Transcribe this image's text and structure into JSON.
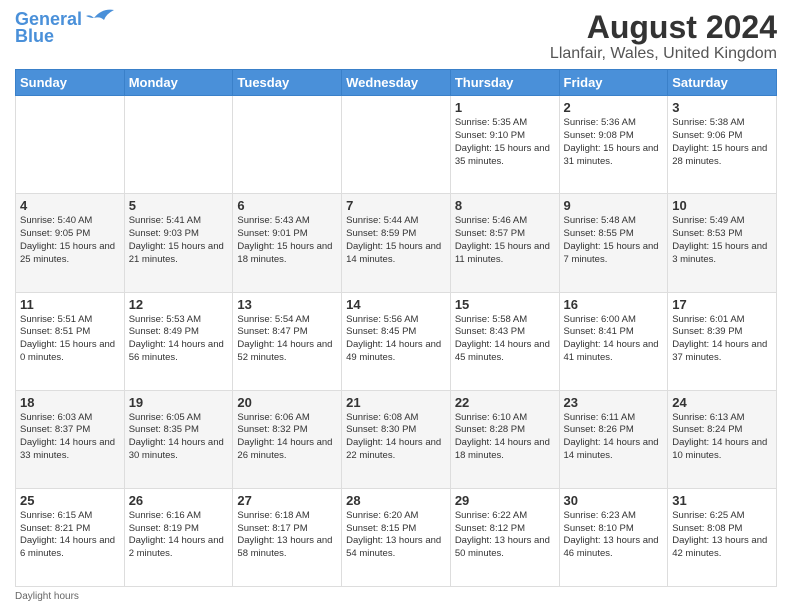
{
  "header": {
    "logo_line1": "General",
    "logo_line2": "Blue",
    "title": "August 2024",
    "subtitle": "Llanfair, Wales, United Kingdom"
  },
  "weekdays": [
    "Sunday",
    "Monday",
    "Tuesday",
    "Wednesday",
    "Thursday",
    "Friday",
    "Saturday"
  ],
  "weeks": [
    [
      {
        "day": "",
        "info": ""
      },
      {
        "day": "",
        "info": ""
      },
      {
        "day": "",
        "info": ""
      },
      {
        "day": "",
        "info": ""
      },
      {
        "day": "1",
        "info": "Sunrise: 5:35 AM\nSunset: 9:10 PM\nDaylight: 15 hours\nand 35 minutes."
      },
      {
        "day": "2",
        "info": "Sunrise: 5:36 AM\nSunset: 9:08 PM\nDaylight: 15 hours\nand 31 minutes."
      },
      {
        "day": "3",
        "info": "Sunrise: 5:38 AM\nSunset: 9:06 PM\nDaylight: 15 hours\nand 28 minutes."
      }
    ],
    [
      {
        "day": "4",
        "info": "Sunrise: 5:40 AM\nSunset: 9:05 PM\nDaylight: 15 hours\nand 25 minutes."
      },
      {
        "day": "5",
        "info": "Sunrise: 5:41 AM\nSunset: 9:03 PM\nDaylight: 15 hours\nand 21 minutes."
      },
      {
        "day": "6",
        "info": "Sunrise: 5:43 AM\nSunset: 9:01 PM\nDaylight: 15 hours\nand 18 minutes."
      },
      {
        "day": "7",
        "info": "Sunrise: 5:44 AM\nSunset: 8:59 PM\nDaylight: 15 hours\nand 14 minutes."
      },
      {
        "day": "8",
        "info": "Sunrise: 5:46 AM\nSunset: 8:57 PM\nDaylight: 15 hours\nand 11 minutes."
      },
      {
        "day": "9",
        "info": "Sunrise: 5:48 AM\nSunset: 8:55 PM\nDaylight: 15 hours\nand 7 minutes."
      },
      {
        "day": "10",
        "info": "Sunrise: 5:49 AM\nSunset: 8:53 PM\nDaylight: 15 hours\nand 3 minutes."
      }
    ],
    [
      {
        "day": "11",
        "info": "Sunrise: 5:51 AM\nSunset: 8:51 PM\nDaylight: 15 hours\nand 0 minutes."
      },
      {
        "day": "12",
        "info": "Sunrise: 5:53 AM\nSunset: 8:49 PM\nDaylight: 14 hours\nand 56 minutes."
      },
      {
        "day": "13",
        "info": "Sunrise: 5:54 AM\nSunset: 8:47 PM\nDaylight: 14 hours\nand 52 minutes."
      },
      {
        "day": "14",
        "info": "Sunrise: 5:56 AM\nSunset: 8:45 PM\nDaylight: 14 hours\nand 49 minutes."
      },
      {
        "day": "15",
        "info": "Sunrise: 5:58 AM\nSunset: 8:43 PM\nDaylight: 14 hours\nand 45 minutes."
      },
      {
        "day": "16",
        "info": "Sunrise: 6:00 AM\nSunset: 8:41 PM\nDaylight: 14 hours\nand 41 minutes."
      },
      {
        "day": "17",
        "info": "Sunrise: 6:01 AM\nSunset: 8:39 PM\nDaylight: 14 hours\nand 37 minutes."
      }
    ],
    [
      {
        "day": "18",
        "info": "Sunrise: 6:03 AM\nSunset: 8:37 PM\nDaylight: 14 hours\nand 33 minutes."
      },
      {
        "day": "19",
        "info": "Sunrise: 6:05 AM\nSunset: 8:35 PM\nDaylight: 14 hours\nand 30 minutes."
      },
      {
        "day": "20",
        "info": "Sunrise: 6:06 AM\nSunset: 8:32 PM\nDaylight: 14 hours\nand 26 minutes."
      },
      {
        "day": "21",
        "info": "Sunrise: 6:08 AM\nSunset: 8:30 PM\nDaylight: 14 hours\nand 22 minutes."
      },
      {
        "day": "22",
        "info": "Sunrise: 6:10 AM\nSunset: 8:28 PM\nDaylight: 14 hours\nand 18 minutes."
      },
      {
        "day": "23",
        "info": "Sunrise: 6:11 AM\nSunset: 8:26 PM\nDaylight: 14 hours\nand 14 minutes."
      },
      {
        "day": "24",
        "info": "Sunrise: 6:13 AM\nSunset: 8:24 PM\nDaylight: 14 hours\nand 10 minutes."
      }
    ],
    [
      {
        "day": "25",
        "info": "Sunrise: 6:15 AM\nSunset: 8:21 PM\nDaylight: 14 hours\nand 6 minutes."
      },
      {
        "day": "26",
        "info": "Sunrise: 6:16 AM\nSunset: 8:19 PM\nDaylight: 14 hours\nand 2 minutes."
      },
      {
        "day": "27",
        "info": "Sunrise: 6:18 AM\nSunset: 8:17 PM\nDaylight: 13 hours\nand 58 minutes."
      },
      {
        "day": "28",
        "info": "Sunrise: 6:20 AM\nSunset: 8:15 PM\nDaylight: 13 hours\nand 54 minutes."
      },
      {
        "day": "29",
        "info": "Sunrise: 6:22 AM\nSunset: 8:12 PM\nDaylight: 13 hours\nand 50 minutes."
      },
      {
        "day": "30",
        "info": "Sunrise: 6:23 AM\nSunset: 8:10 PM\nDaylight: 13 hours\nand 46 minutes."
      },
      {
        "day": "31",
        "info": "Sunrise: 6:25 AM\nSunset: 8:08 PM\nDaylight: 13 hours\nand 42 minutes."
      }
    ]
  ],
  "footer": {
    "daylight_label": "Daylight hours"
  }
}
